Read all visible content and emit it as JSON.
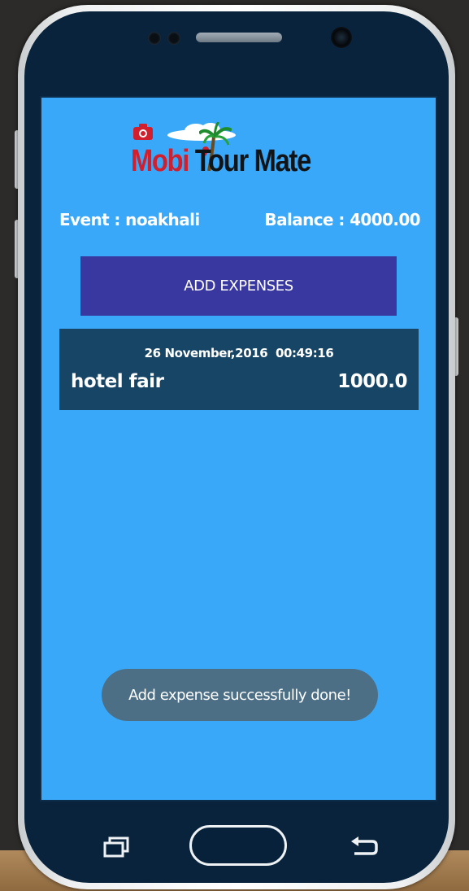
{
  "app": {
    "logo_part1": "Mobi",
    "logo_part2": "Tour Mate"
  },
  "header": {
    "event_label": "Event : noakhali",
    "balance_label": "Balance : 4000.00"
  },
  "actions": {
    "add_expenses_label": "ADD EXPENSES"
  },
  "expenses": [
    {
      "datetime": "26 November,2016  00:49:16",
      "name": "hotel fair",
      "amount": "1000.0"
    }
  ],
  "toast": {
    "message": "Add expense successfully done!"
  },
  "colors": {
    "screen_background": "#3aa8f9",
    "button_background": "#3937a0",
    "card_background": "#174565",
    "toast_background": "#4d6f86",
    "logo_red": "#d21f2d"
  },
  "icons": {
    "nav_recent": "recent-apps-icon",
    "nav_home": "home-button",
    "nav_back": "back-arrow-icon",
    "logo_camera": "camera-icon",
    "logo_palm": "palm-tree-icon"
  }
}
